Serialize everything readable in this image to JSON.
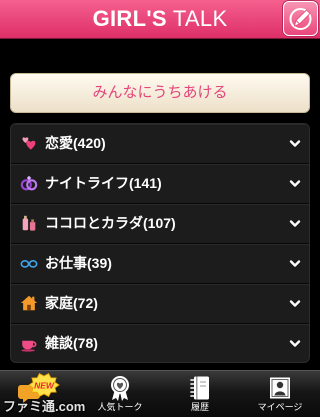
{
  "header": {
    "title_bold": "GIRL'S",
    "title_light": "TALK",
    "compose_icon": "pencil-edit-icon"
  },
  "post_button": {
    "label": "みんなにうちあける"
  },
  "categories": [
    {
      "label": "恋愛(420)",
      "icon": "hearts-icon"
    },
    {
      "label": "ナイトライフ(141)",
      "icon": "rings-icon"
    },
    {
      "label": "ココロとカラダ(107)",
      "icon": "bottles-icon"
    },
    {
      "label": "お仕事(39)",
      "icon": "glasses-icon"
    },
    {
      "label": "家庭(72)",
      "icon": "house-icon"
    },
    {
      "label": "雑談(78)",
      "icon": "teacup-icon"
    }
  ],
  "tabbar": {
    "tabs": [
      {
        "icon": "speech-bubble-icon",
        "badge": "NEW"
      },
      {
        "label": "人気トーク",
        "icon": "ribbon-award-icon"
      },
      {
        "label": "履歴",
        "icon": "notebook-icon"
      },
      {
        "label": "マイページ",
        "icon": "id-card-icon"
      }
    ]
  },
  "watermark": "ファミ通.com",
  "colors": {
    "header_top": "#f5608f",
    "header_bottom": "#de2f68",
    "accent": "#e4467b",
    "list_bg": "#1c1c1c",
    "post_button_top": "#fffaf0",
    "post_button_bottom": "#ece0c8"
  }
}
